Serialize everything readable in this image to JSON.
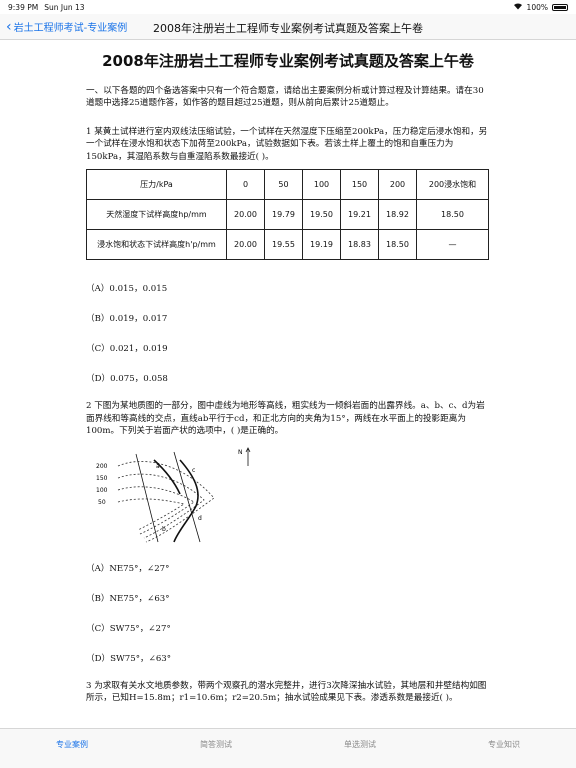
{
  "status": {
    "time": "9:39 PM",
    "date": "Sun Jun 13",
    "battery": "100%"
  },
  "nav": {
    "back_label": "岩土工程师考试-专业案例",
    "title": "2008年注册岩土工程师专业案例考试真题及答案上午卷"
  },
  "doc": {
    "title": "2008年注册岩土工程师专业案例考试真题及答案上午卷",
    "intro": "一、以下各题的四个备选答案中只有一个符合题意，请给出主要案例分析或计算过程及计算结果。请在30道题中选择25道题作答，如作答的题目超过25道题，则从前向后累计25道题止。",
    "q1": {
      "text": "1 某黄土试样进行室内双线法压缩试验，一个试样在天然湿度下压缩至200kPa，压力稳定后浸水饱和，另一个试样在浸水饱和状态下加荷至200kPa，试验数据如下表。若该土样上覆土的饱和自重压力为150kPa，其湿陷系数与自重湿陷系数最接近( )。",
      "table": {
        "header": [
          "压力/kPa",
          "0",
          "50",
          "100",
          "150",
          "200",
          "200浸水饱和"
        ],
        "rows": [
          [
            "天然湿度下试样高度hp/mm",
            "20.00",
            "19.79",
            "19.50",
            "19.21",
            "18.92",
            "18.50"
          ],
          [
            "浸水饱和状态下试样高度h'p/mm",
            "20.00",
            "19.55",
            "19.19",
            "18.83",
            "18.50",
            "—"
          ]
        ]
      },
      "options": [
        "（A）0.015，0.015",
        "（B）0.019，0.017",
        "（C）0.021，0.019",
        "（D）0.075，0.058"
      ]
    },
    "q2": {
      "text": "2 下图为某地质图的一部分，图中虚线为地形等高线，粗实线为一倾斜岩面的出露界线。a、b、c、d为岩面界线和等高线的交点，直线ab平行于cd，和正北方向的夹角为15°，两线在水平面上的投影距离为100m。下列关于岩面产状的选项中，( )是正确的。",
      "map_labels": {
        "north": "N",
        "contours": [
          "200",
          "150",
          "100",
          "50"
        ],
        "points": [
          "a",
          "b",
          "c",
          "d"
        ]
      },
      "options": [
        "（A）NE75°，∠27°",
        "（B）NE75°，∠63°",
        "（C）SW75°，∠27°",
        "（D）SW75°，∠63°"
      ]
    },
    "q3": {
      "text": "3 为求取有关水文地质参数，带两个观察孔的潜水完整井，进行3次降深抽水试验，其地层和井壁结构如图所示，已知H=15.8m；r1=10.6m；r2=20.5m；抽水试验成果见下表。渗透系数是最接近( )。"
    }
  },
  "tabs": [
    "专业案例",
    "简答测试",
    "单选测试",
    "专业知识"
  ]
}
